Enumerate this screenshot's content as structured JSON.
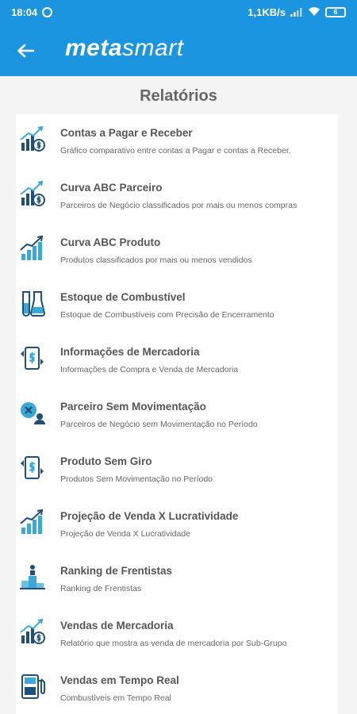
{
  "status_bar": {
    "time": "18:04",
    "network_speed": "1,1KB/s",
    "battery": "6"
  },
  "header": {
    "brand_bold": "meta",
    "brand_light": "smart"
  },
  "page": {
    "title": "Relatórios"
  },
  "colors": {
    "appbar": "#1b95e0",
    "icon_dark": "#1f4f7a",
    "icon_light": "#3aa9d8"
  },
  "reports": [
    {
      "icon": "chart-dollar-icon",
      "title": "Contas a Pagar e Receber",
      "description": "Gráfico comparativo entre contas a Pagar e contas a Receber."
    },
    {
      "icon": "chart-dollar-icon",
      "title": "Curva ABC Parceiro",
      "description": "Parceiros de Negócio classificados por mais ou menos compras"
    },
    {
      "icon": "growth-chart-icon",
      "title": "Curva ABC Produto",
      "description": "Produtos classificados por mais ou menos vendidos"
    },
    {
      "icon": "flask-icon",
      "title": "Estoque de Combustível",
      "description": "Estoque de Combustíveis com Precisão de Encerramento"
    },
    {
      "icon": "phone-dollar-icon",
      "title": "Informações de Mercadoria",
      "description": "Informações de Compra e Venda de Mercadoria"
    },
    {
      "icon": "partner-x-icon",
      "title": "Parceiro Sem Movimentação",
      "description": "Parceiros de Negócio sem Movimentação no Período"
    },
    {
      "icon": "phone-dollar-icon",
      "title": "Produto Sem Giro",
      "description": "Produtos Sem Movimentação no Período"
    },
    {
      "icon": "growth-chart-icon",
      "title": "Projeção de Venda X Lucratividade",
      "description": "Projeção de Venda X Lucratividade"
    },
    {
      "icon": "podium-icon",
      "title": "Ranking de Frentistas",
      "description": "Ranking de Frentistas"
    },
    {
      "icon": "chart-dollar-icon",
      "title": "Vendas de Mercadoria",
      "description": "Relatório que mostra as venda de mercadoria por Sub-Grupo"
    },
    {
      "icon": "fuel-pump-icon",
      "title": "Vendas em Tempo Real",
      "description": "Combustíveis em Tempo Real"
    }
  ]
}
